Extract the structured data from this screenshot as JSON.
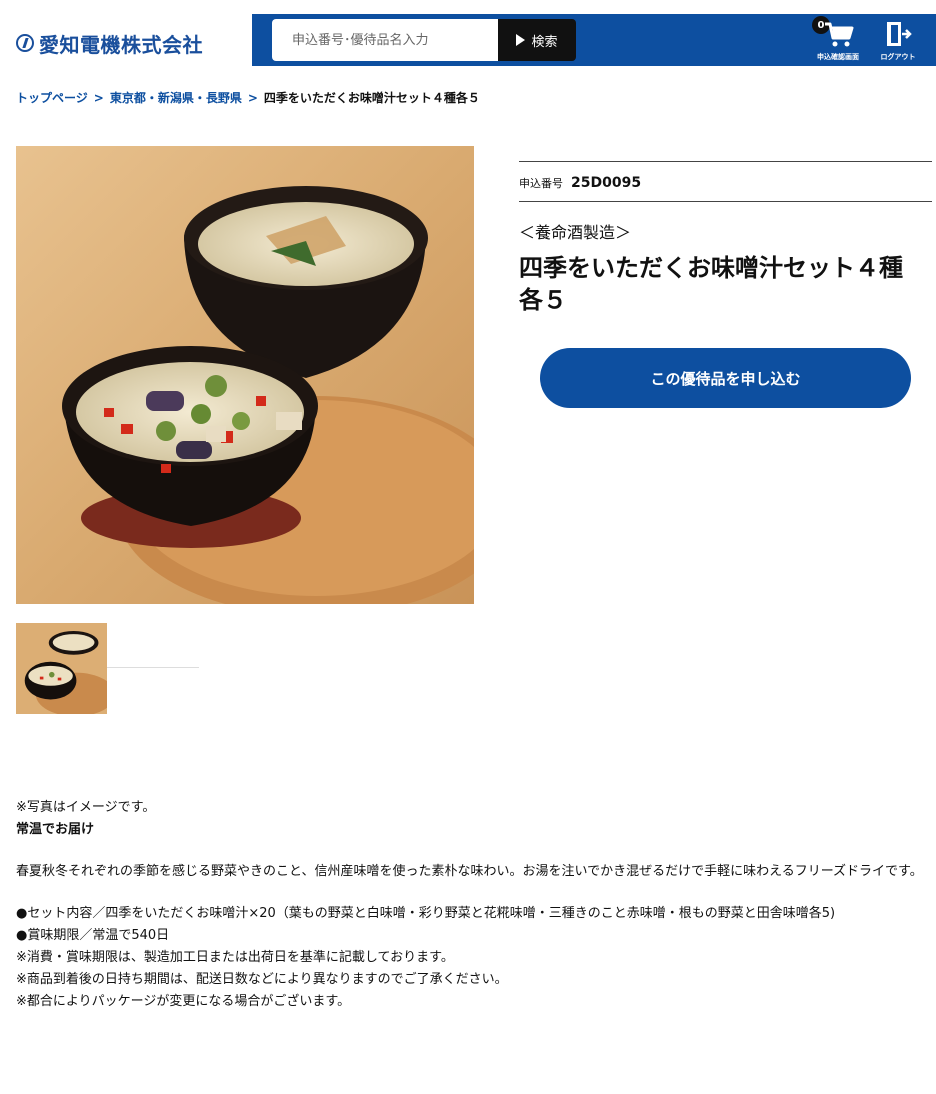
{
  "header": {
    "logo_text": "愛知電機株式会社",
    "search_placeholder": "申込番号･優待品名入力",
    "search_button": "検索",
    "cart_count": "0",
    "cart_label": "申込確認画面",
    "logout_label": "ログアウト",
    "brand_color": "#0d4fa0"
  },
  "breadcrumb": {
    "home": "トップページ",
    "sep": ">",
    "category": "東京都・新潟県・長野県",
    "current": "四季をいただくお味噌汁セット４種各５"
  },
  "product": {
    "app_no_label": "申込番号",
    "app_no_value": "25D0095",
    "maker": "＜養命酒製造＞",
    "title": "四季をいただくお味噌汁セット４種各５",
    "apply_button": "この優待品を申し込む",
    "image_alt": "miso-soup-bowls-image"
  },
  "description": {
    "note": "※写真はイメージです。",
    "delivery": "常温でお届け",
    "body": "春夏秋冬それぞれの季節を感じる野菜やきのこと、信州産味噌を使った素朴な味わい。お湯を注いでかき混ぜるだけで手軽に味わえるフリーズドライです。",
    "contents": "●セット内容／四季をいただくお味噌汁×20（葉もの野菜と白味噌・彩り野菜と花糀味噌・三種きのこと赤味噌・根もの野菜と田舎味噌各5)",
    "expiry": "●賞味期限／常温で540日",
    "note1": "※消費・賞味期限は、製造加工日または出荷日を基準に記載しております。",
    "note2": "※商品到着後の日持ち期間は、配送日数などにより異なりますのでご了承ください。",
    "note3": "※都合によりパッケージが変更になる場合がございます。"
  }
}
